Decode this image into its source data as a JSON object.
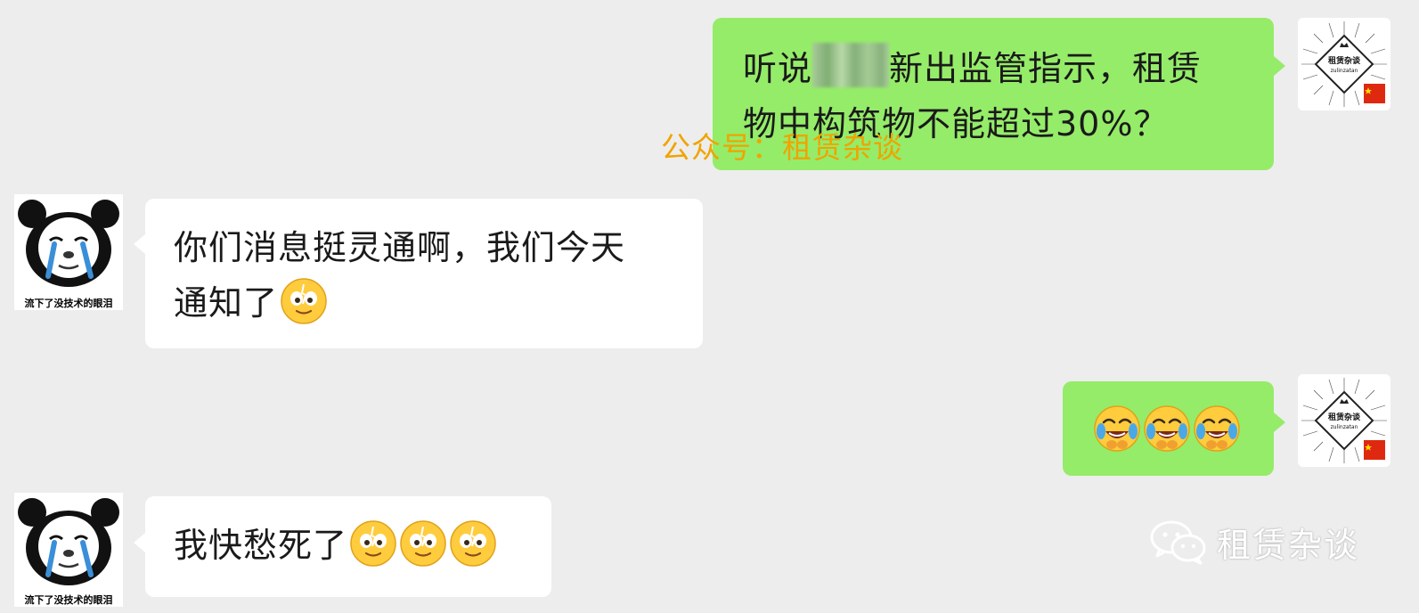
{
  "messages": [
    {
      "id": "m1",
      "direction": "outgoing",
      "line1_prefix": "听说",
      "line1_suffix": "新出监管指示，租赁",
      "line2": "物中构筑物不能超过30%？",
      "has_redaction": true
    },
    {
      "id": "m2",
      "direction": "incoming",
      "line1": "你们消息挺灵通啊，我们今天",
      "line2": "通知了",
      "emojis": [
        "crying-smile-emoji"
      ]
    },
    {
      "id": "m3",
      "direction": "outgoing",
      "emojis": [
        "laughing-crying-emoji",
        "laughing-crying-emoji",
        "laughing-crying-emoji"
      ]
    },
    {
      "id": "m4",
      "direction": "incoming",
      "line1": "我快愁死了",
      "emojis": [
        "crying-smile-emoji",
        "crying-smile-emoji",
        "crying-smile-emoji"
      ]
    }
  ],
  "avatars": {
    "incoming_caption": "流下了没技术的眼泪",
    "outgoing_logo_title": "租赁杂谈",
    "outgoing_logo_sub": "zulinzatan"
  },
  "watermark": "公众号：租赁杂谈",
  "brand": {
    "label": "租赁杂谈",
    "icon": "wechat-icon"
  },
  "colors": {
    "background": "#ededed",
    "outgoing_bubble": "#95ec69",
    "incoming_bubble": "#ffffff",
    "watermark": "#f0a400",
    "text": "#1a1a1a"
  }
}
